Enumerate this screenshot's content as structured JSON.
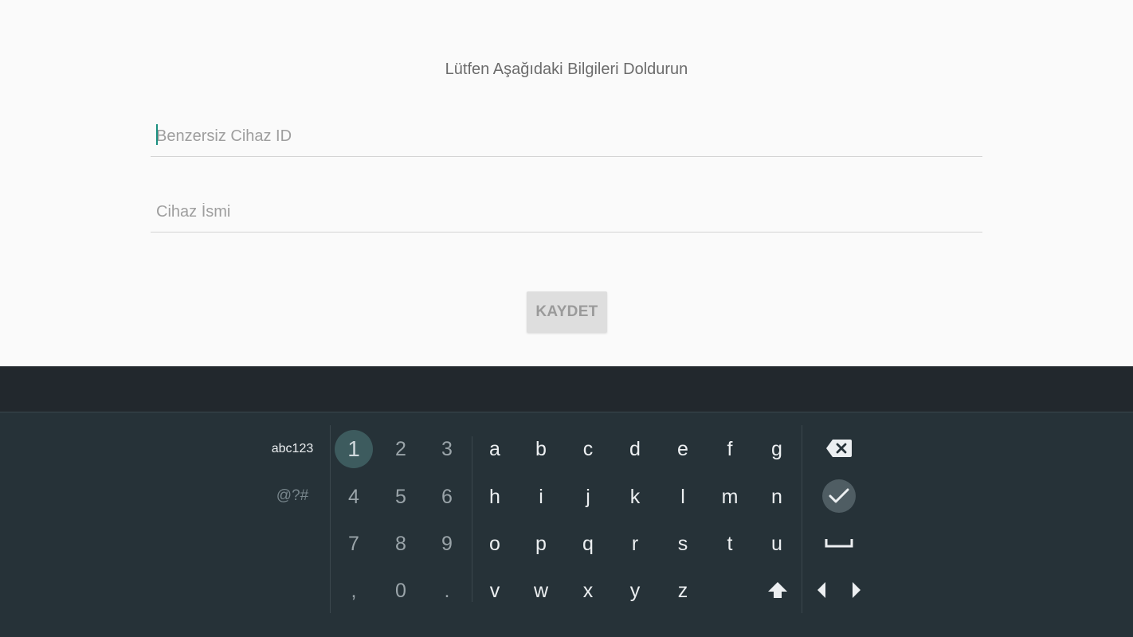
{
  "form": {
    "title": "Lütfen Aşağıdaki Bilgileri Doldurun",
    "device_id": {
      "value": "",
      "placeholder": "Benzersiz Cihaz ID"
    },
    "device_name": {
      "value": "",
      "placeholder": "Cihaz İsmi"
    },
    "save_label": "KAYDET"
  },
  "keyboard": {
    "mode_abc": "abc123",
    "mode_symbols": "@?#",
    "numbers": [
      "1",
      "2",
      "3",
      "4",
      "5",
      "6",
      "7",
      "8",
      "9",
      ",",
      "0",
      "."
    ],
    "letters": [
      "a",
      "b",
      "c",
      "d",
      "e",
      "f",
      "g",
      "h",
      "i",
      "j",
      "k",
      "l",
      "m",
      "n",
      "o",
      "p",
      "q",
      "r",
      "s",
      "t",
      "u",
      "v",
      "w",
      "x",
      "y",
      "z"
    ],
    "focused_key": "1",
    "icons": {
      "backspace": "backspace-icon",
      "done": "check-icon",
      "space": "space-bar-icon",
      "shift": "shift-arrow-icon",
      "left": "cursor-left-icon",
      "right": "cursor-right-icon"
    }
  },
  "colors": {
    "background": "#fafafa",
    "keyboard_bg": "#263238",
    "keyboard_top_bar": "#22282d",
    "accent_cursor": "#1a8f7f",
    "focus_ring": "#3d5b5e"
  }
}
